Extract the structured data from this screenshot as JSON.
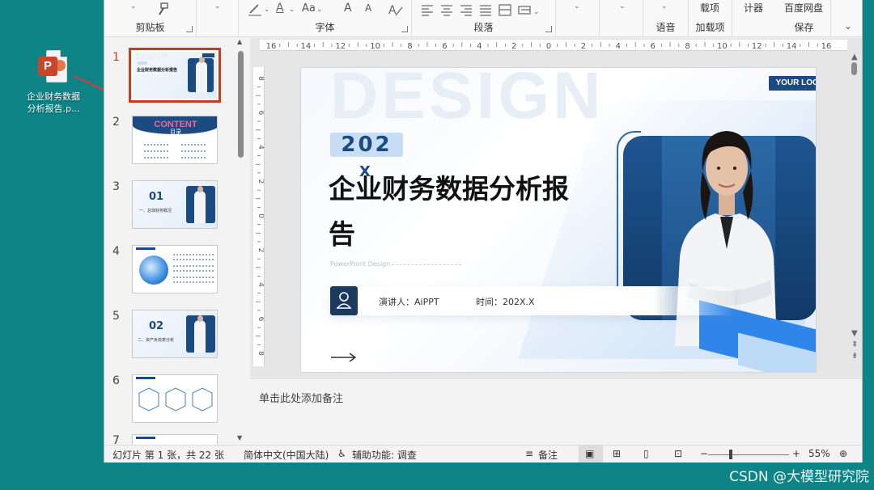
{
  "desktop": {
    "file_label_line1": "企业财务数据",
    "file_label_line2": "分析报告.p..."
  },
  "watermark": "CSDN @大模型研究院",
  "ribbon": {
    "clipboard_group": "剪贴板",
    "font_group": "字体",
    "paragraph_group": "段落",
    "voice_group": "语音",
    "addins_top": "载项",
    "addins_group": "加载项",
    "calculator_label": "计器",
    "baidu_label": "百度网盘",
    "save_group": "保存",
    "font_buttons": [
      "A",
      "A",
      "Aa"
    ]
  },
  "thumbnails": [
    {
      "num": "1",
      "kind": "cover",
      "title": "企业财务数据分析报告"
    },
    {
      "num": "2",
      "kind": "contents",
      "title": "CONTENT",
      "subtitle": "目录"
    },
    {
      "num": "3",
      "kind": "section",
      "section_num": "01",
      "section_text": "一、总体财务概况"
    },
    {
      "num": "4",
      "kind": "text-image"
    },
    {
      "num": "5",
      "kind": "section",
      "section_num": "02",
      "section_text": "二、资产负债表分析"
    },
    {
      "num": "6",
      "kind": "hexagons"
    },
    {
      "num": "7",
      "kind": "partial"
    }
  ],
  "ruler": {
    "h_labels": [
      "16",
      "14",
      "12",
      "10",
      "8",
      "6",
      "4",
      "2",
      "0",
      "2",
      "4",
      "6",
      "8",
      "10",
      "12",
      "14",
      "16"
    ],
    "v_labels": [
      "8",
      "6",
      "4",
      "2",
      "0",
      "2",
      "4",
      "6",
      "8"
    ]
  },
  "slide": {
    "bg_word": "DESIGN",
    "logo": "YOUR LOGO",
    "year": "202",
    "year_suffix": "X",
    "title_line1": "企业财务数据分析报",
    "title_line2": "告",
    "subtitle": "PowerPoint Design",
    "presenter": "演讲人：AiPPT",
    "time": "时间：202X.X",
    "colors": {
      "navy": "#1b4b80",
      "dark_navy": "#1b3a5e",
      "accent_blue": "#2f86e8",
      "light_blue": "#c7def5"
    }
  },
  "notes": {
    "placeholder": "单击此处添加备注"
  },
  "statusbar": {
    "slide_info": "幻灯片 第 1 张，共 22 张",
    "language": "简体中文(中国大陆)",
    "accessibility": "辅助功能: 调查",
    "notes_button": "备注",
    "zoom_minus": "−",
    "zoom_plus": "+",
    "zoom": "55%"
  }
}
